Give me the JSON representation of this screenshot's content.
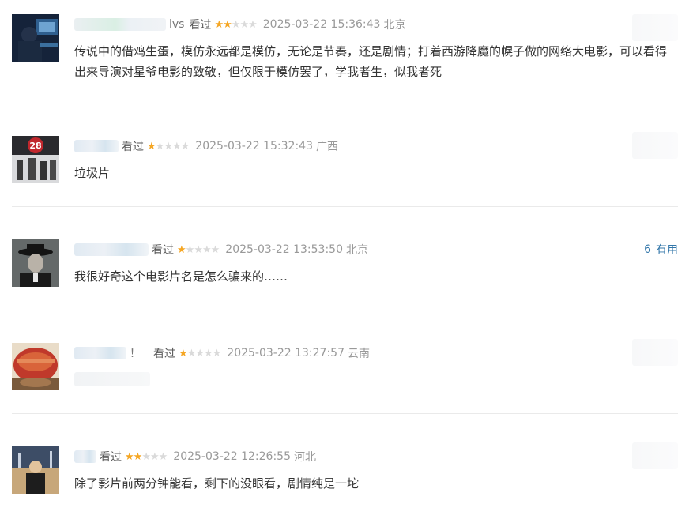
{
  "comments": [
    {
      "user": "lvs",
      "status": "看过",
      "rating": 2,
      "time": "2025-03-22 15:36:43",
      "location": "北京",
      "text": "传说中的借鸡生蛋，模仿永远都是模仿，无论是节奏，还是剧情；打着西游降魔的幌子做的网络大电影，可以看得出来导演对星爷电影的致敬，但仅限于模仿罢了，学我者生，似我者死",
      "useful_count": "",
      "useful_label": ""
    },
    {
      "user": "",
      "status": "看过",
      "rating": 1,
      "time": "2025-03-22 15:32:43",
      "location": "广西",
      "text": "垃圾片",
      "useful_count": "",
      "useful_label": ""
    },
    {
      "user": "",
      "status": "看过",
      "rating": 1,
      "time": "2025-03-22 13:53:50",
      "location": "北京",
      "text": "我很好奇这个电影片名是怎么骗来的……",
      "useful_count": "6",
      "useful_label": "有用"
    },
    {
      "user": "！",
      "status": "看过",
      "rating": 1,
      "time": "2025-03-22 13:27:57",
      "location": "云南",
      "text": "",
      "useful_count": "",
      "useful_label": ""
    },
    {
      "user": "",
      "status": "看过",
      "rating": 2,
      "time": "2025-03-22 12:26:55",
      "location": "河北",
      "text": "除了影片前两分钟能看，剩下的没眼看，剧情纯是一坨",
      "useful_count": "",
      "useful_label": ""
    }
  ],
  "colors": {
    "star_on": "#f5a623",
    "star_off": "#dadada",
    "link": "#3377aa"
  }
}
